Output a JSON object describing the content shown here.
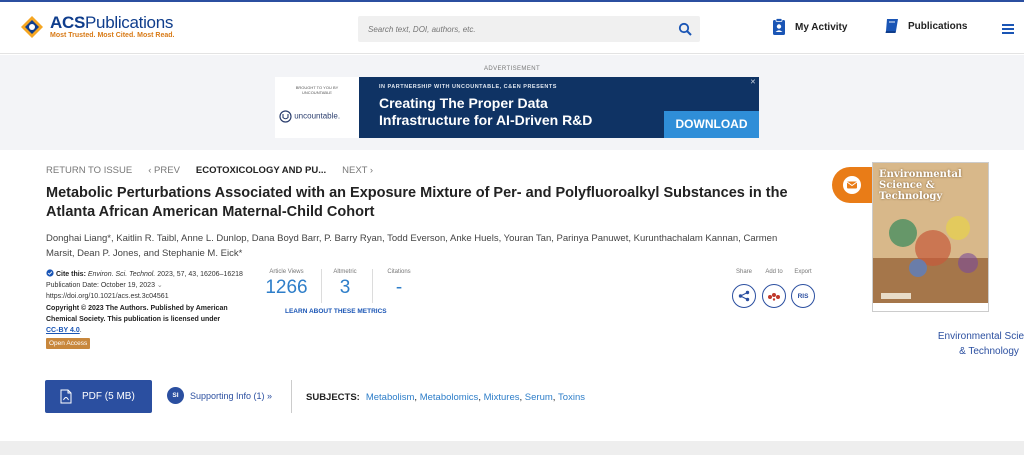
{
  "header": {
    "logo_title_bold": "ACS",
    "logo_title_rest": "Publications",
    "logo_tagline": "Most Trusted. Most Cited. Most Read.",
    "search_placeholder": "Search text, DOI, authors, etc.",
    "my_activity": "My Activity",
    "publications": "Publications",
    "colors": {
      "brand": "#2b4fa0",
      "accent": "#d87a16"
    }
  },
  "ad": {
    "label": "ADVERTISEMENT",
    "brought_by": "BROUGHT TO YOU BY UNCOUNTABLE",
    "brand": "uncountable.",
    "kicker": "IN PARTNERSHIP WITH UNCOUNTABLE, C&EN PRESENTS",
    "headline": "Creating The Proper Data Infrastructure for AI-Driven R&D",
    "button": "DOWNLOAD"
  },
  "nav": {
    "return": "RETURN TO ISSUE",
    "prev": "‹ PREV",
    "current": "ECOTOXICOLOGY AND PU...",
    "next": "NEXT ›"
  },
  "article": {
    "title": "Metabolic Perturbations Associated with an Exposure Mixture of Per- and Polyfluoroalkyl Substances in the Atlanta African American Maternal-Child Cohort",
    "authors": "Donghai Liang*, Kaitlin R. Taibl, Anne L. Dunlop, Dana Boyd Barr, P. Barry Ryan, Todd Everson, Anke Huels, Youran Tan, Parinya Panuwet, Kurunthachalam Kannan, Carmen Marsit, Dean P. Jones, and Stephanie M. Eick*"
  },
  "cite": {
    "label": "Cite this:",
    "journal": "Environ. Sci. Technol.",
    "ref": "2023, 57, 43, 16206–16218",
    "pub_date": "Publication Date: October 19, 2023",
    "doi": "https://doi.org/10.1021/acs.est.3c04561",
    "copyright": "Copyright © 2023 The Authors. Published by American Chemical Society. This publication is licensed under",
    "license": "CC-BY 4.0",
    "open_access": "Open Access"
  },
  "metrics": {
    "views_label": "Article Views",
    "views": "1266",
    "altmetric_label": "Altmetric",
    "altmetric": "3",
    "citations_label": "Citations",
    "citations": "-",
    "learn_more": "LEARN ABOUT THESE METRICS"
  },
  "actions": {
    "share": "Share",
    "add_to": "Add to",
    "export": "Export",
    "ris": "RIS"
  },
  "cover": {
    "cover_title": "Environmental Science & Technology",
    "journal_line1": "Environmental Science",
    "journal_line2": "& Technology"
  },
  "footer": {
    "pdf": "PDF (5 MB)",
    "si_badge": "SI",
    "supporting": "Supporting Info (1) »",
    "subjects_label": "SUBJECTS:",
    "subjects": [
      "Metabolism",
      "Metabolomics",
      "Mixtures",
      "Serum",
      "Toxins"
    ]
  }
}
